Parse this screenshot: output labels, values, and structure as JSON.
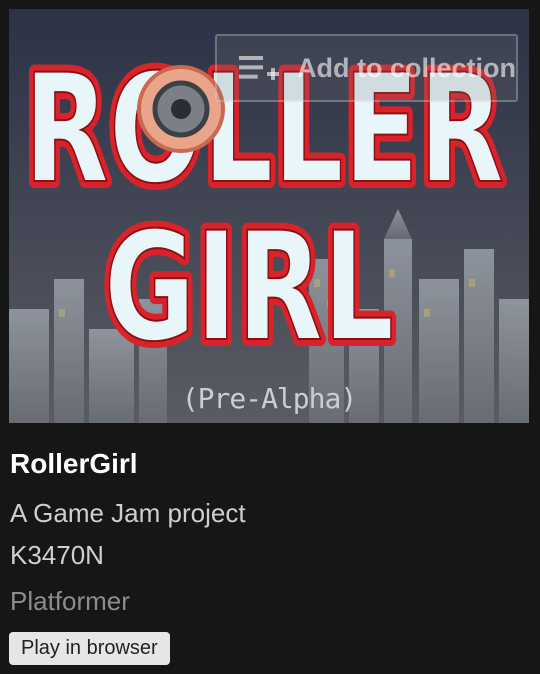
{
  "game": {
    "title": "RollerGirl",
    "description": "A Game Jam project",
    "author": "K3470N",
    "genre": "Platformer"
  },
  "thumbnail": {
    "logo_line1": "ROLLER",
    "logo_line2": "GIRL",
    "subtitle": "(Pre-Alpha)"
  },
  "actions": {
    "add_to_collection": "Add to collection",
    "add_to_collection_icon": "collection-list-icon",
    "play_in_browser": "Play in browser"
  },
  "colors": {
    "background": "#161616",
    "logo_red": "#d8232a",
    "logo_fill": "#e8f6fa",
    "button_bg": "#e6e6e6"
  }
}
